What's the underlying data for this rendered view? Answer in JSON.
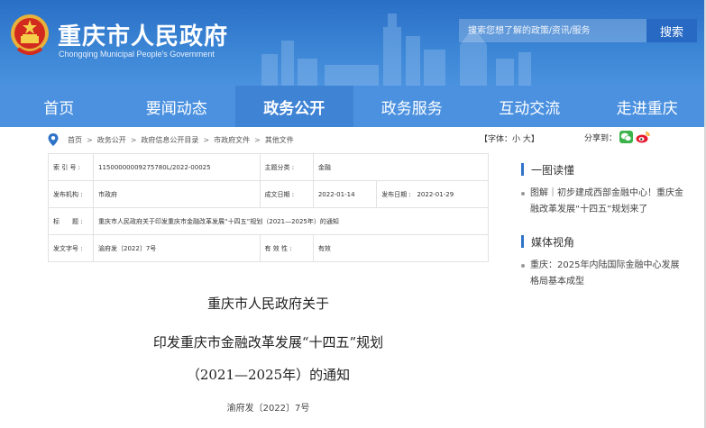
{
  "header": {
    "title": "重庆市人民政府",
    "subtitle": "Chongqing Municipal People's Government",
    "search_placeholder": "搜索您想了解的政策/资讯/服务",
    "search_button": "搜索"
  },
  "nav": {
    "items": [
      "首页",
      "要闻动态",
      "政务公开",
      "政务服务",
      "互动交流",
      "走进重庆"
    ],
    "active": "政务公开"
  },
  "breadcrumb": [
    "首页",
    "政务公开",
    "政府信息公开目录",
    "市政府文件",
    "其他文件"
  ],
  "breadcrumb_sep": ">",
  "font_size_label": "【字体：小 大】",
  "share_label": "分享到：",
  "info": {
    "index_label": "索 引 号 :",
    "index_value": "11500000009275780L/2022-00025",
    "category_label": "主题分类 :",
    "category_value": "金融",
    "issuer_label": "发布机构 :",
    "issuer_value": "市政府",
    "created_label": "成文日期 :",
    "created_value": "2022-01-14",
    "published_label": "发布日期 :",
    "published_value": "2022-01-29",
    "title_label": "标　　题 :",
    "title_value": "重庆市人民政府关于印发重庆市金融改革发展“十四五”规划（2021—2025年）的通知",
    "docno_label": "发文字号 :",
    "docno_value": "渝府发〔2022〕7号",
    "valid_label": "有 效 性 :",
    "valid_value": "有效"
  },
  "sidebar": {
    "section1": "一图读懂",
    "section1_items": [
      "图解｜初步建成西部金融中心！重庆金融改革发展“十四五”规划来了"
    ],
    "section2": "媒体视角",
    "section2_items": [
      "重庆：2025年内陆国际金融中心发展格局基本成型"
    ]
  },
  "article": {
    "title_line1": "重庆市人民政府关于",
    "title_line2": "印发重庆市金融改革发展“十四五”规划",
    "title_line3": "（2021—2025年）的通知",
    "doc_no": "渝府发〔2022〕7号"
  },
  "colors": {
    "header_blue": "#2a6fc6",
    "nav_blue": "#4b91e0",
    "accent": "#2f73c8"
  }
}
